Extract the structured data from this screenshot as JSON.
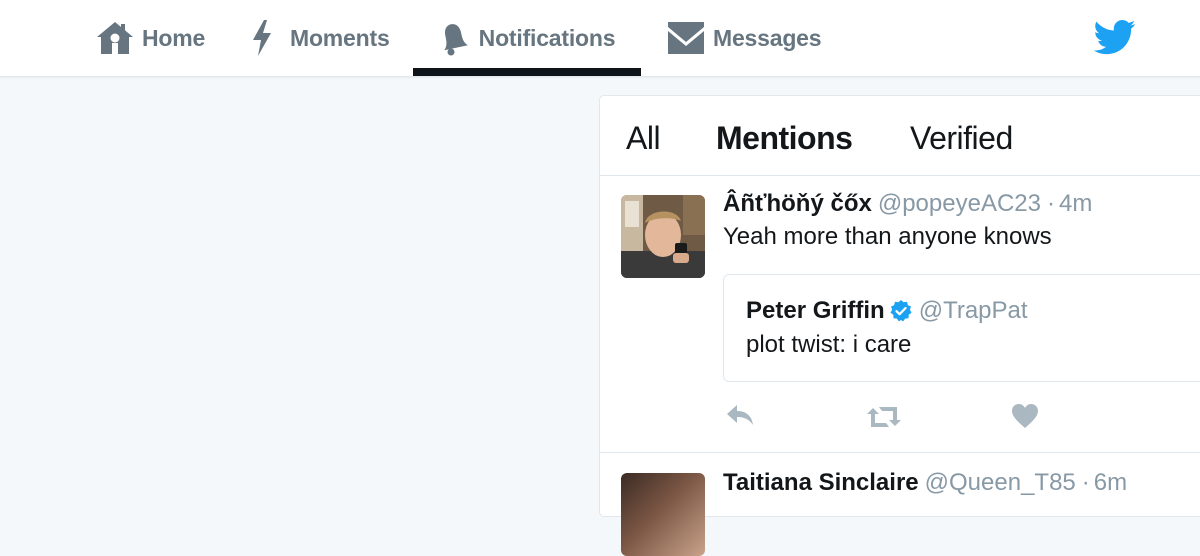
{
  "nav": {
    "items": [
      {
        "label": "Home",
        "icon": "home-icon"
      },
      {
        "label": "Moments",
        "icon": "lightning-icon"
      },
      {
        "label": "Notifications",
        "icon": "bell-icon",
        "active": true
      },
      {
        "label": "Messages",
        "icon": "envelope-icon"
      }
    ],
    "logo_icon": "twitter-bird-icon"
  },
  "tabs": [
    {
      "label": "All"
    },
    {
      "label": "Mentions",
      "active": true
    },
    {
      "label": "Verified"
    }
  ],
  "tweet": {
    "name": "Âñťhöňý čőx",
    "handle": "@popeyeAC23",
    "dot": "·",
    "time": "4m",
    "text": "Yeah more than anyone knows",
    "quote": {
      "name": "Peter Griffin",
      "verified": true,
      "handle": "@TrapPat",
      "text": "plot twist: i care"
    },
    "actions": [
      "reply-icon",
      "retweet-icon",
      "like-icon"
    ]
  },
  "next_tweet": {
    "name": "Taitiana Sinclaire",
    "handle": "@Queen_T85",
    "dot": "·",
    "time": "6m"
  },
  "colors": {
    "page_bg": "#f5f8fa",
    "nav_text": "#66757f",
    "active_underline": "#0f1419",
    "twitter_blue": "#1da1f2",
    "secondary_text": "#8899a6",
    "border": "#e1e8ed",
    "action_icon": "#aab8c2"
  }
}
